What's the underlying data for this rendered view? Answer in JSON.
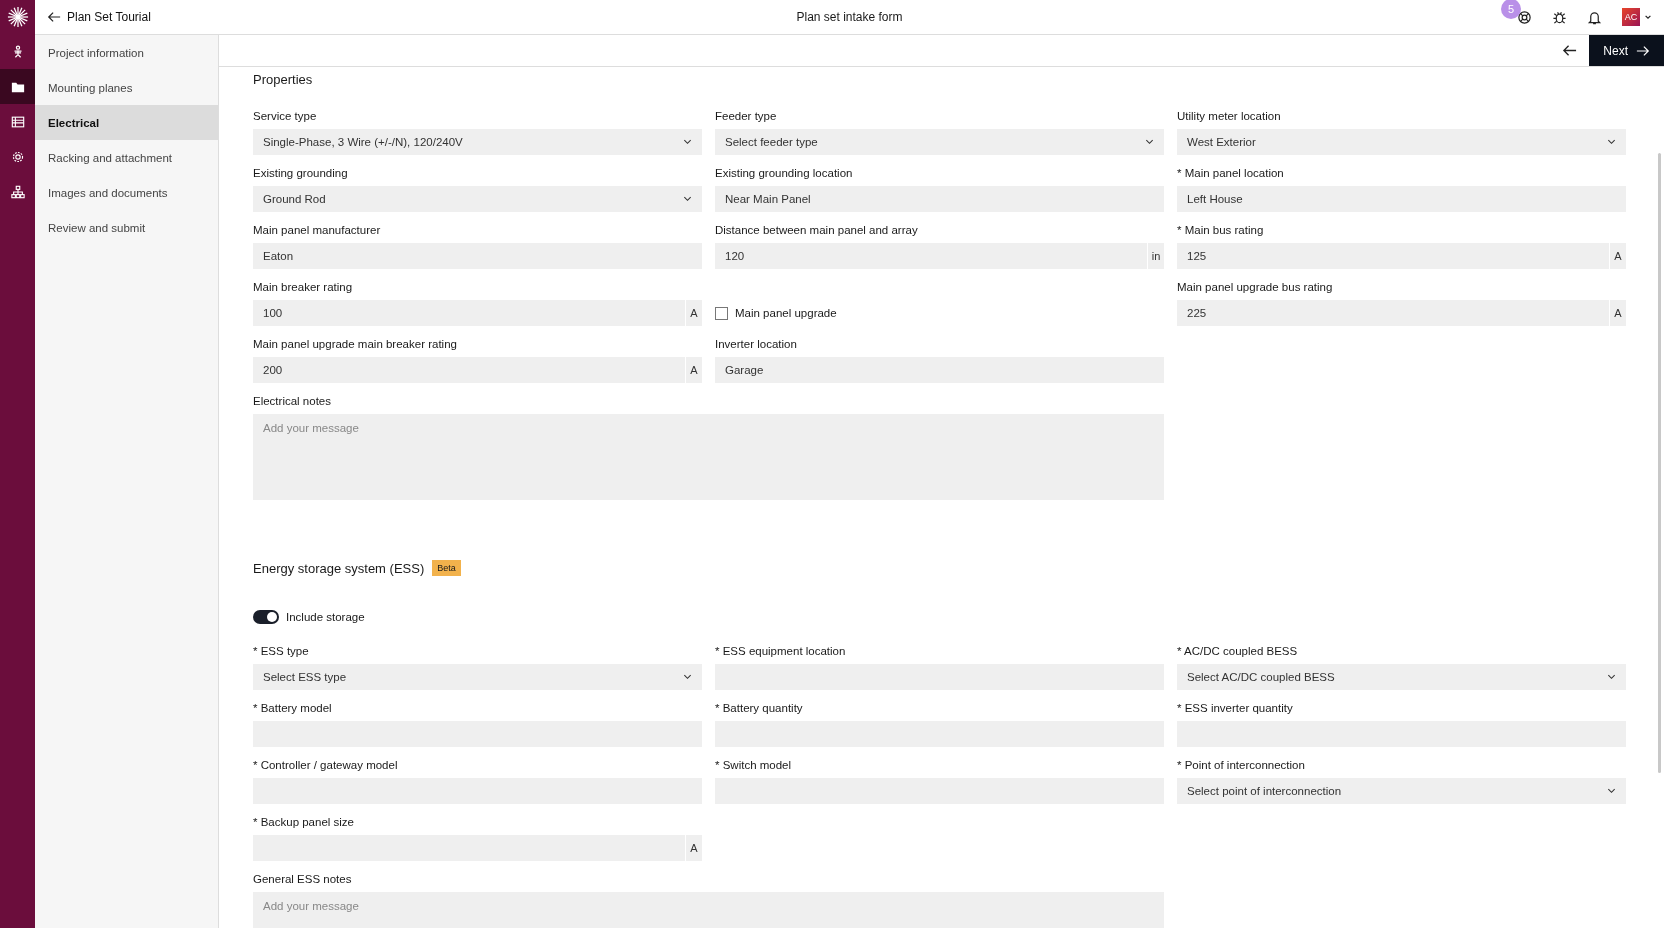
{
  "header": {
    "back_label": "Plan Set Tourial",
    "title": "Plan set intake form",
    "notification_count": "5",
    "avatar_initials": "AC"
  },
  "rail": [
    {
      "selected": false
    },
    {
      "selected": true
    },
    {
      "selected": false
    },
    {
      "selected": false
    },
    {
      "selected": false
    }
  ],
  "sidebar": {
    "items": [
      {
        "label": "Project information",
        "selected": false
      },
      {
        "label": "Mounting planes",
        "selected": false
      },
      {
        "label": "Electrical",
        "selected": true
      },
      {
        "label": "Racking and attachment",
        "selected": false
      },
      {
        "label": "Images and documents",
        "selected": false
      },
      {
        "label": "Review and submit",
        "selected": false
      }
    ]
  },
  "toolbar": {
    "next_label": "Next"
  },
  "sections": [
    {
      "title": "Properties",
      "rows": [
        [
          {
            "kind": "select",
            "label": "Service type",
            "value": "Single-Phase, 3 Wire (+/-/N), 120/240V"
          },
          {
            "kind": "select",
            "label": "Feeder type",
            "placeholder": "Select feeder type"
          },
          {
            "kind": "select",
            "label": "Utility meter location",
            "value": "West Exterior"
          }
        ],
        [
          {
            "kind": "select",
            "label": "Existing grounding",
            "value": "Ground Rod"
          },
          {
            "kind": "text",
            "label": "Existing grounding location",
            "value": "Near Main Panel"
          },
          {
            "kind": "text",
            "label": "* Main panel location",
            "value": "Left House"
          }
        ],
        [
          {
            "kind": "text",
            "label": "Main panel manufacturer",
            "value": "Eaton"
          },
          {
            "kind": "unit",
            "label": "Distance between main panel and array",
            "value": "120",
            "unit": "in"
          },
          {
            "kind": "unit",
            "label": "* Main bus rating",
            "value": "125",
            "unit": "A"
          }
        ],
        [
          {
            "kind": "unit",
            "label": "Main breaker rating",
            "value": "100",
            "unit": "A"
          },
          {
            "kind": "checkbox",
            "label": "Main panel upgrade",
            "checked": false
          },
          {
            "kind": "unit",
            "label": "Main panel upgrade bus rating",
            "value": "225",
            "unit": "A"
          }
        ],
        [
          {
            "kind": "unit",
            "label": "Main panel upgrade main breaker rating",
            "value": "200",
            "unit": "A"
          },
          {
            "kind": "text",
            "label": "Inverter location",
            "value": "Garage"
          }
        ],
        [
          {
            "kind": "textarea",
            "label": "Electrical notes",
            "placeholder": "Add your message"
          }
        ]
      ]
    },
    {
      "title": "Energy storage system (ESS)",
      "badge": "Beta",
      "toggle": {
        "label": "Include storage",
        "on": true
      },
      "rows": [
        [
          {
            "kind": "select",
            "label": "* ESS type",
            "placeholder": "Select ESS type"
          },
          {
            "kind": "text",
            "label": "* ESS equipment location"
          },
          {
            "kind": "select",
            "label": "* AC/DC coupled BESS",
            "placeholder": "Select AC/DC coupled BESS"
          }
        ],
        [
          {
            "kind": "text",
            "label": "* Battery model"
          },
          {
            "kind": "text",
            "label": "* Battery quantity"
          },
          {
            "kind": "text",
            "label": "* ESS inverter quantity"
          }
        ],
        [
          {
            "kind": "text",
            "label": "* Controller / gateway model"
          },
          {
            "kind": "text",
            "label": "* Switch model"
          },
          {
            "kind": "select",
            "label": "* Point of interconnection",
            "placeholder": "Select point of interconnection"
          }
        ],
        [
          {
            "kind": "unit",
            "label": "* Backup panel size",
            "unit": "A"
          }
        ],
        [
          {
            "kind": "textarea",
            "label": "General ESS notes",
            "placeholder": "Add your message"
          }
        ]
      ]
    }
  ]
}
